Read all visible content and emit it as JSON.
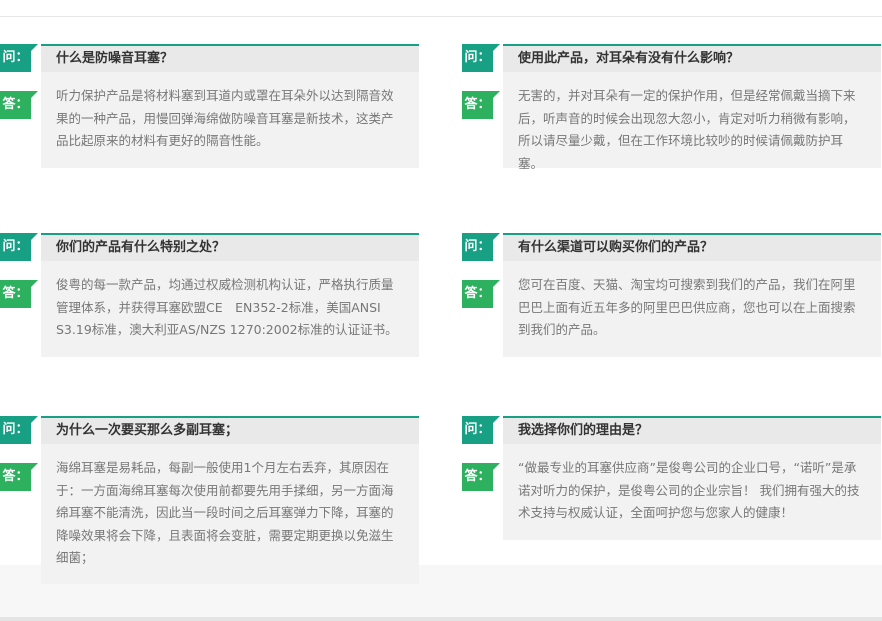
{
  "labels": {
    "question": "问：",
    "answer": "答："
  },
  "colors": {
    "question_tag": "#17a084",
    "answer_tag": "#2db15f",
    "bar_bg": "#e9e9e9",
    "answer_bg": "#f2f2f2"
  },
  "faqs": [
    {
      "question": "什么是防噪音耳塞？",
      "answer": "听力保护产品是将材料塞到耳道内或罩在耳朵外以达到隔音效果的一种产品，用慢回弹海绵做防噪音耳塞是新技术，这类产品比起原来的材料有更好的隔音性能。"
    },
    {
      "question": "使用此产品，对耳朵有没有什么影响？",
      "answer": "无害的，并对耳朵有一定的保护作用，但是经常佩戴当摘下来后，听声音的时候会出现忽大忽小，肯定对听力稍微有影响，所以请尽量少戴，但在工作环境比较吵的时候请佩戴防护耳塞。"
    },
    {
      "question": "你们的产品有什么特别之处？",
      "answer": "俊粤的每一款产品，均通过权威检测机构认证，严格执行质量管理体系，并获得耳塞欧盟CE　EN352-2标准，美国ANSI S3.19标准，澳大利亚AS/NZS 1270:2002标准的认证证书。"
    },
    {
      "question": "有什么渠道可以购买你们的产品？",
      "answer": "您可在百度、天猫、淘宝均可搜索到我们的产品，我们在阿里巴巴上面有近五年多的阿里巴巴供应商，您也可以在上面搜索到我们的产品。"
    },
    {
      "question": "为什么一次要买那么多副耳塞；",
      "answer": "海绵耳塞是易耗品，每副一般使用1个月左右丢弃，其原因在于：一方面海绵耳塞每次使用前都要先用手揉细，另一方面海绵耳塞不能清洗，因此当一段时间之后耳塞弹力下降，耳塞的降噪效果将会下降，且表面将会变脏，需要定期更换以免滋生细菌；"
    },
    {
      "question": "我选择你们的理由是？",
      "answer": "“做最专业的耳塞供应商”是俊粤公司的企业口号，“诺听”是承诺对听力的保护，是俊粤公司的企业宗旨！ 我们拥有强大的技术支持与权威认证，全面呵护您与您家人的健康！"
    }
  ]
}
